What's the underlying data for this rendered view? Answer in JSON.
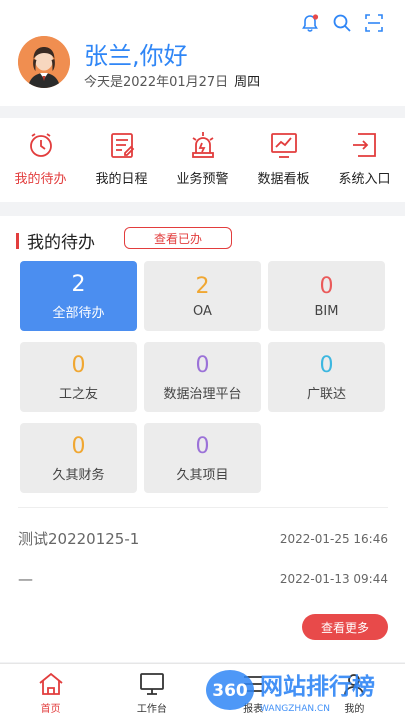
{
  "header": {
    "greeting": "张兰,你好",
    "date_text": "今天是2022年01月27日",
    "weekday": "周四"
  },
  "quick_entries": [
    {
      "label": "我的待办",
      "icon": "clock-icon",
      "active": true
    },
    {
      "label": "我的日程",
      "icon": "schedule-icon",
      "active": false
    },
    {
      "label": "业务预警",
      "icon": "alarm-icon",
      "active": false
    },
    {
      "label": "数据看板",
      "icon": "dashboard-icon",
      "active": false
    },
    {
      "label": "系统入口",
      "icon": "login-icon",
      "active": false
    }
  ],
  "todo": {
    "title": "我的待办",
    "view_done": "查看已办",
    "tiles": [
      {
        "count": "2",
        "label": "全部待办",
        "color": "#ffffff"
      },
      {
        "count": "2",
        "label": "OA",
        "color": "#f0a732"
      },
      {
        "count": "0",
        "label": "BIM",
        "color": "#ea5a5a"
      },
      {
        "count": "0",
        "label": "工之友",
        "color": "#f0a732"
      },
      {
        "count": "0",
        "label": "数据治理平台",
        "color": "#9b72d8"
      },
      {
        "count": "0",
        "label": "广联达",
        "color": "#3cb7e0"
      },
      {
        "count": "0",
        "label": "久其财务",
        "color": "#f0a732"
      },
      {
        "count": "0",
        "label": "久其项目",
        "color": "#9b72d8"
      }
    ],
    "records": [
      {
        "title": "测试20220125-1",
        "date": "2022-01-25 16:46"
      },
      {
        "title": "—",
        "date": "2022-01-13 09:44"
      }
    ],
    "more_label": "查看更多"
  },
  "tabbar": [
    {
      "label": "首页",
      "icon": "home-icon",
      "active": true
    },
    {
      "label": "工作台",
      "icon": "monitor-icon",
      "active": false
    },
    {
      "label": "报表",
      "icon": "report-icon",
      "active": false
    },
    {
      "label": "我的",
      "icon": "user-icon",
      "active": false
    }
  ],
  "watermark": {
    "logo": "360",
    "title": "网站排行榜",
    "url": "WANGZHAN.CN"
  }
}
